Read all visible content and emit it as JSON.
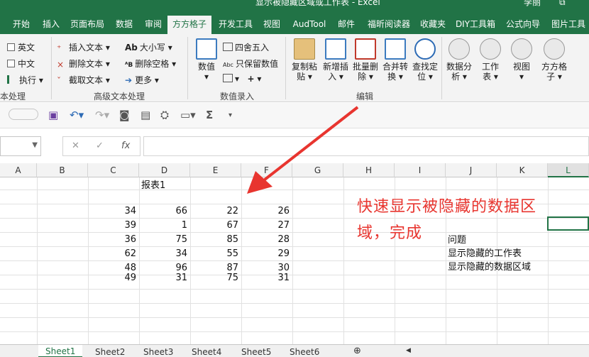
{
  "window": {
    "title": "显示被隐藏区域或工作表 - Excel",
    "user": "李丽"
  },
  "ribbon_tabs": [
    "开始",
    "插入",
    "页面布局",
    "数据",
    "审阅",
    "方方格子",
    "开发工具",
    "视图",
    "AudTool",
    "邮件",
    "福昕阅读器",
    "收藏夹",
    "DIY工具箱",
    "公式向导",
    "图片工具"
  ],
  "active_tab": "方方格子",
  "ribbon": {
    "text_group": {
      "english": "英文",
      "chinese": "中文",
      "execute": "执行",
      "label": "本处理"
    },
    "advanced_group": {
      "insert_text": "插入文本",
      "delete_text": "删除文本",
      "extract_text": "截取文本",
      "case": "大小写",
      "delete_space": "删除空格",
      "more": "更多",
      "label": "高级文本处理"
    },
    "numeric_group": {
      "value": "数值",
      "round": "四舍五入",
      "keep_values": "只保留数值",
      "label": "数值录入"
    },
    "edit_group": {
      "copy_paste": [
        "复制粘",
        "贴"
      ],
      "add_insert": [
        "新增插",
        "入"
      ],
      "batch_delete": [
        "批量删",
        "除"
      ],
      "merge_convert": [
        "合并转",
        "换"
      ],
      "find_locate": [
        "查找定",
        "位"
      ],
      "label": "编辑"
    },
    "right_group": {
      "data_analysis": [
        "数据分",
        "析"
      ],
      "worksheet": [
        "工作",
        "表"
      ],
      "view": [
        "视图",
        ""
      ],
      "fangfang": [
        "方方格",
        "子"
      ]
    }
  },
  "formula_bar": {
    "cancel": "✕",
    "confirm": "✓",
    "fx": "fx"
  },
  "columns": [
    "A",
    "B",
    "C",
    "D",
    "E",
    "F",
    "G",
    "H",
    "I",
    "J",
    "K",
    "L"
  ],
  "selected_column": "L",
  "sheet": {
    "report_title": "报表1",
    "rows": [
      [
        34,
        66,
        22,
        26
      ],
      [
        39,
        1,
        67,
        27
      ],
      [
        36,
        75,
        85,
        28
      ],
      [
        62,
        34,
        55,
        29
      ],
      [
        48,
        96,
        87,
        30
      ],
      [
        49,
        31,
        75,
        31
      ]
    ],
    "notes": [
      "问题",
      "显示隐藏的工作表",
      "显示隐藏的数据区域"
    ]
  },
  "annotation": {
    "line1": "快速显示被隐藏的数据区",
    "line2": "域，完成",
    "color": "#e8352f"
  },
  "sheet_tabs": [
    "Sheet1",
    "Sheet2",
    "Sheet3",
    "Sheet4",
    "Sheet5",
    "Sheet6"
  ],
  "active_sheet": "Sheet1",
  "colors": {
    "brand": "#217346",
    "ribbon_bg": "#f3f3f3",
    "annotation": "#e8352f"
  }
}
